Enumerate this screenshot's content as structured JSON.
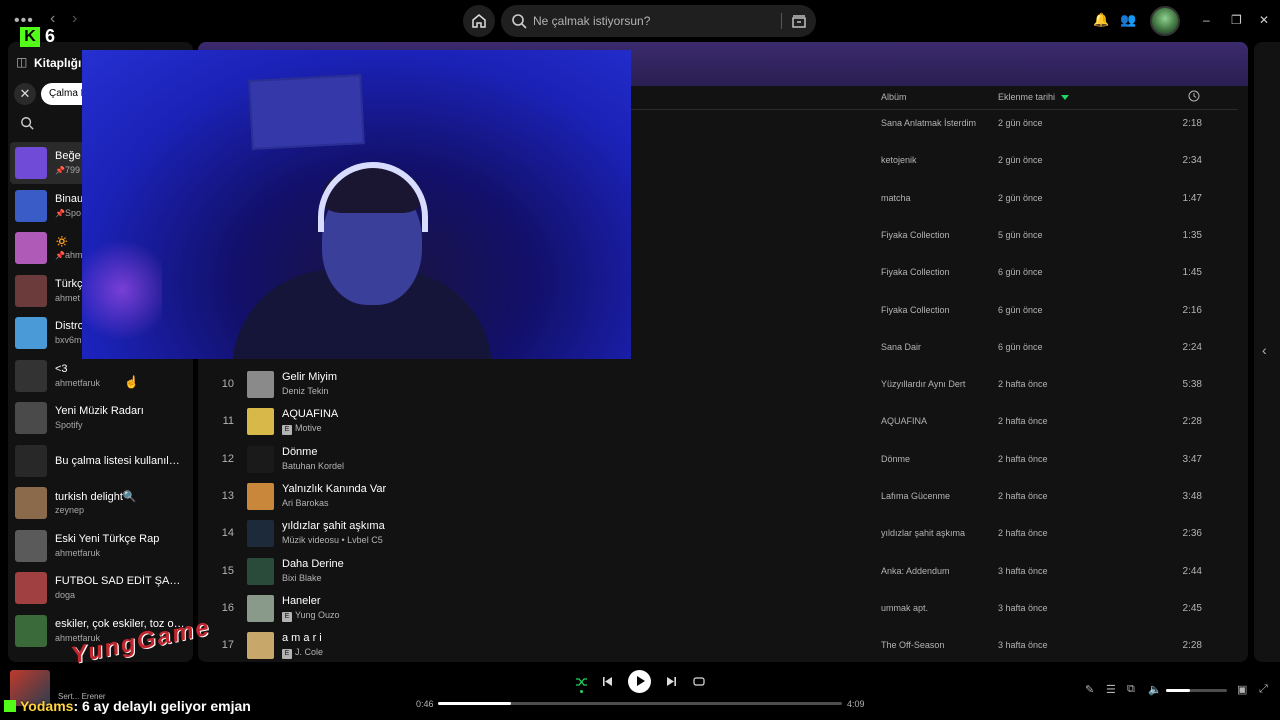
{
  "topbar": {
    "dots": "•••",
    "back": "‹",
    "forward": "›",
    "search_placeholder": "Ne çalmak istiyorsun?",
    "minimize": "–",
    "maximize": "❐",
    "close": "✕"
  },
  "stream": {
    "viewers": "6",
    "watermark": "YungGame",
    "chat_user": "Yodams",
    "chat_message": ": 6 ay delaylı geliyor emjan"
  },
  "sidebar": {
    "title": "Kitaplığın",
    "filter_chip": "Çalma L",
    "items": [
      {
        "name": "Beğe",
        "sub": "799",
        "pinned": true,
        "color": "#6f4bd8"
      },
      {
        "name": "Binau",
        "sub": "Spo",
        "pinned": true,
        "color": "#3a5cc7"
      },
      {
        "name": "🔅",
        "sub": "ahm",
        "pinned": true,
        "color": "#b05ab8"
      },
      {
        "name": "Türkç",
        "sub": "ahmet",
        "pinned": false,
        "color": "#6b3a3a"
      },
      {
        "name": "Distro",
        "sub": "bxv6m",
        "pinned": false,
        "color": "#4a9ad8"
      },
      {
        "name": "<3",
        "sub": "ahmetfaruk",
        "pinned": false,
        "color": "#333333"
      },
      {
        "name": "Yeni Müzik Radarı",
        "sub": "Spotify",
        "pinned": false,
        "color": "#4a4a4a"
      },
      {
        "name": "Bu çalma listesi kullanılamıyor",
        "sub": "",
        "pinned": false,
        "color": "#282828"
      },
      {
        "name": "turkish delight🔍",
        "sub": "zeynep",
        "pinned": false,
        "color": "#8a6a4a"
      },
      {
        "name": "Eski Yeni Türkçe Rap",
        "sub": "ahmetfaruk",
        "pinned": false,
        "color": "#5a5a5a"
      },
      {
        "name": "FUTBOL SAD EDİT ŞARKILARI",
        "sub": "doga",
        "pinned": false,
        "color": "#a04040"
      },
      {
        "name": "eskiler, çok eskiler, toz olmuşlar",
        "sub": "ahmetfaruk",
        "pinned": false,
        "color": "#3a6a3a"
      }
    ]
  },
  "table": {
    "col_album": "Albüm",
    "col_date": "Eklenme tarihi",
    "col_duration_icon": "clock-icon",
    "rows": [
      {
        "num": "",
        "title": "",
        "artist": "",
        "explicit": false,
        "album": "Sana Anlatmak İsterdim",
        "date": "2 gün önce",
        "duration": "2:18",
        "color": "#333"
      },
      {
        "num": "",
        "title": "",
        "artist": "",
        "explicit": false,
        "album": "ketojenik",
        "date": "2 gün önce",
        "duration": "2:34",
        "color": "#333"
      },
      {
        "num": "",
        "title": "",
        "artist": "",
        "explicit": false,
        "album": "matcha",
        "date": "2 gün önce",
        "duration": "1:47",
        "color": "#333"
      },
      {
        "num": "",
        "title": "",
        "artist": "",
        "explicit": false,
        "album": "Fiyaka Collection",
        "date": "5 gün önce",
        "duration": "1:35",
        "color": "#333"
      },
      {
        "num": "",
        "title": "",
        "artist": "",
        "explicit": false,
        "album": "Fiyaka Collection",
        "date": "6 gün önce",
        "duration": "1:45",
        "color": "#333"
      },
      {
        "num": "",
        "title": "",
        "artist": "",
        "explicit": false,
        "album": "Fiyaka Collection",
        "date": "6 gün önce",
        "duration": "2:16",
        "color": "#333"
      },
      {
        "num": "",
        "title": "",
        "artist": "",
        "explicit": false,
        "album": "Sana Dair",
        "date": "6 gün önce",
        "duration": "2:24",
        "color": "#333"
      },
      {
        "num": "10",
        "title": "Gelir Miyim",
        "artist": "Deniz Tekin",
        "explicit": false,
        "album": "Yüzyıllardır Aynı Dert",
        "date": "2 hafta önce",
        "duration": "5:38",
        "color": "#8a8a8a"
      },
      {
        "num": "11",
        "title": "AQUAFINA",
        "artist": "Motive",
        "explicit": true,
        "album": "AQUAFINA",
        "date": "2 hafta önce",
        "duration": "2:28",
        "color": "#d9b84a"
      },
      {
        "num": "12",
        "title": "Dönme",
        "artist": "Batuhan Kordel",
        "explicit": false,
        "album": "Dönme",
        "date": "2 hafta önce",
        "duration": "3:47",
        "color": "#1a1a1a"
      },
      {
        "num": "13",
        "title": "Yalnızlık Kanında Var",
        "artist": "Ari Barokas",
        "explicit": false,
        "album": "Lafıma Gücenme",
        "date": "2 hafta önce",
        "duration": "3:48",
        "color": "#c8873a"
      },
      {
        "num": "14",
        "title": "yıldızlar şahit aşkıma",
        "artist": "Müzik videosu • Lvbel C5",
        "explicit": false,
        "album": "yıldızlar şahit aşkıma",
        "date": "2 hafta önce",
        "duration": "2:36",
        "color": "#1c2a3a"
      },
      {
        "num": "15",
        "title": "Daha Derine",
        "artist": "Bixi Blake",
        "explicit": false,
        "album": "Anka: Addendum",
        "date": "3 hafta önce",
        "duration": "2:44",
        "color": "#2a4a3a"
      },
      {
        "num": "16",
        "title": "Haneler",
        "artist": "Yung Ouzo",
        "explicit": true,
        "album": "ummak apt.",
        "date": "3 hafta önce",
        "duration": "2:45",
        "color": "#8a9a8a"
      },
      {
        "num": "17",
        "title": "a m a r i",
        "artist": "J. Cole",
        "explicit": true,
        "album": "The Off-Season",
        "date": "3 hafta önce",
        "duration": "2:28",
        "color": "#c8a86a"
      }
    ]
  },
  "player": {
    "artist": "Sert... Erener",
    "elapsed": "0:46",
    "total": "4:09",
    "progress_fraction": 0.18,
    "volume_fraction": 0.4,
    "accent": "#1ed760"
  }
}
